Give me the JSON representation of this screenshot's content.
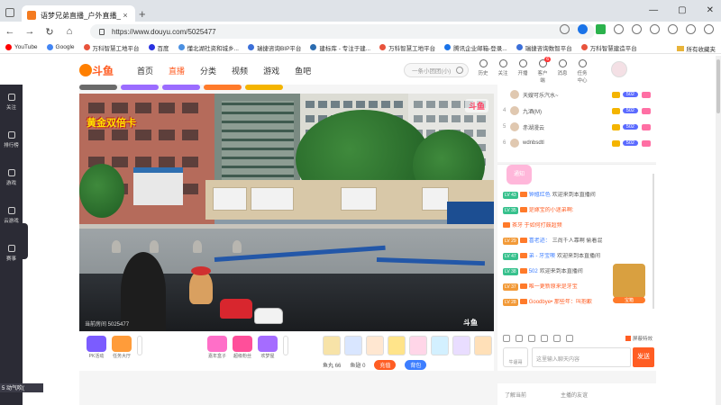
{
  "browser": {
    "tab_title": "语梦兄弟直播_户外直播_斗鱼",
    "tab_close": "×",
    "new_tab": "+",
    "url": "https://www.douyu.com/5025477",
    "window_controls": [
      "—",
      "▢",
      "✕"
    ]
  },
  "bookmarks": [
    {
      "label": "YouTube",
      "color": "#ff0000"
    },
    {
      "label": "Google",
      "color": "#4285f4"
    },
    {
      "label": "万科智慧工地平台",
      "color": "#e8533c"
    },
    {
      "label": "百度",
      "color": "#2932e1"
    },
    {
      "label": "懂北湖社资和城乡...",
      "color": "#4a90e2"
    },
    {
      "label": "瑞捷咨询BIP平台",
      "color": "#3b6fd9"
    },
    {
      "label": "建标库 - 专注于建...",
      "color": "#2b6cb0"
    },
    {
      "label": "万科智慧工地平台",
      "color": "#e8533c"
    },
    {
      "label": "腾讯企业邮箱-登录...",
      "color": "#1a73e8"
    },
    {
      "label": "瑞捷咨询数智平台",
      "color": "#3b6fd9"
    },
    {
      "label": "万科智慧建造平台",
      "color": "#e8533c"
    }
  ],
  "bookmarks_other": "所有收藏夹",
  "douyu": {
    "logo": "斗鱼",
    "nav": [
      "首页",
      "直播",
      "分类",
      "视频",
      "游戏",
      "鱼吧"
    ],
    "search_placeholder": "一条小团团(小)",
    "header_icons": [
      {
        "label": "历史",
        "icon": "history-icon"
      },
      {
        "label": "关注",
        "icon": "follow-icon"
      },
      {
        "label": "开播",
        "icon": "live-icon"
      },
      {
        "label": "客户端",
        "icon": "client-icon",
        "badge": "6"
      },
      {
        "label": "消息",
        "icon": "message-icon"
      },
      {
        "label": "任务中心",
        "icon": "task-icon"
      }
    ]
  },
  "sidebar": [
    {
      "label": "关注",
      "icon": "heart-icon"
    },
    {
      "label": "排行榜",
      "icon": "rank-icon"
    },
    {
      "label": "游戏",
      "icon": "game-icon"
    },
    {
      "label": "云游戏",
      "icon": "cloud-game-icon"
    },
    {
      "label": "赛事",
      "icon": "trophy-icon"
    }
  ],
  "sidebar_bottom": "5 动气吹(",
  "video": {
    "tag_left": "黄金双倍卡",
    "tag_right": "斗鱼",
    "watermark": "当前房间 5025477",
    "logo": "斗鱼"
  },
  "gifts": [
    {
      "label": "PK活动",
      "color": "#7b5cff"
    },
    {
      "label": "任务大厅",
      "color": "#ff9c3a"
    },
    {
      "label": "嘉年盒子",
      "color": "#ff6fc8"
    },
    {
      "label": "超级粉丝",
      "color": "#ff4f9a"
    },
    {
      "label": "欢梦屋",
      "color": "#a56cff"
    }
  ],
  "funds": {
    "fish_balls_label": "鱼丸",
    "fish_balls": "66",
    "fish_wings_label": "鱼翅",
    "fish_wings": "0",
    "charge": "充值",
    "bag": "背包"
  },
  "rank_list": [
    {
      "num": "",
      "name": "天嫂可乐汽水~",
      "level": "502"
    },
    {
      "num": "4",
      "name": "九酒(M)",
      "level": "502"
    },
    {
      "num": "5",
      "name": "赤湖漫云",
      "level": "502"
    },
    {
      "num": "6",
      "name": "wdnbsdtl",
      "level": "502"
    }
  ],
  "chat": {
    "notice": "通知",
    "messages": [
      {
        "lv": "LV 43",
        "lvc": "green",
        "user": "钟馗红色",
        "text": "欢迎来到本直播间"
      },
      {
        "lv": "LV 35",
        "lvc": "green",
        "user": "",
        "text": "是嫁宝的小迷弟啊:",
        "hl": true
      },
      {
        "lv": "",
        "lvc": "",
        "user": "",
        "text": "茶牙 于如何打鼓超频",
        "hl": true
      },
      {
        "lv": "LV 29",
        "lvc": "orange",
        "user": "喜老迹：",
        "text": "三尚千人靠啊 偷着混"
      },
      {
        "lv": "LV 47",
        "lvc": "green",
        "user": "弟 - 牙宝噢",
        "text": "欢迎来到本直播间"
      },
      {
        "lv": "LV 38",
        "lvc": "green",
        "user": "502",
        "text": "欢迎来到本直播间"
      },
      {
        "lv": "LV 37",
        "lvc": "orange",
        "user": "",
        "text": "唯一更新原来是牙宝",
        "hl": true
      },
      {
        "lv": "LV 28",
        "lvc": "orange",
        "user": "",
        "text": "Goodbye• 那些年：叫抱歉",
        "hl": true
      }
    ],
    "treasure_label": "宝箱",
    "block_effects": "屏蔽特效",
    "fan_badge": "牛逼哥",
    "input_placeholder": "这里输入聊天内容",
    "send": "发送"
  },
  "lower_panel": {
    "left": "了解当前",
    "right": "主播的友谊"
  }
}
